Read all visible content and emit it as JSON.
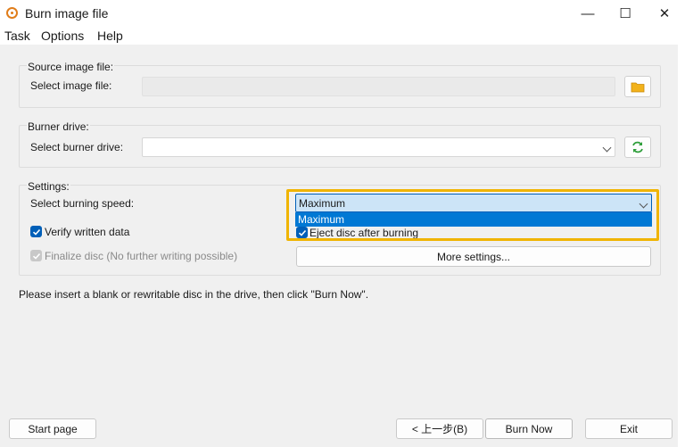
{
  "window": {
    "title": "Burn image file",
    "controls": {
      "minimize": "—",
      "maximize": "☐",
      "close": "✕"
    }
  },
  "menu": [
    "Task",
    "Options",
    "Help"
  ],
  "source": {
    "group_label": "Source image file:",
    "field_label": "Select image file:",
    "value": ""
  },
  "burner": {
    "group_label": "Burner drive:",
    "field_label": "Select burner drive:",
    "value": ""
  },
  "settings": {
    "group_label": "Settings:",
    "speed_label": "Select burning speed:",
    "speed_value": "Maximum",
    "speed_options": [
      "Maximum"
    ],
    "verify_label": "Verify written data",
    "verify_checked": true,
    "finalize_label": "Finalize disc (No further writing possible)",
    "finalize_checked": true,
    "eject_label": "Eject disc after burning",
    "eject_checked": true,
    "more_settings": "More settings..."
  },
  "status_text": "Please insert a blank or rewritable disc in the drive, then click \"Burn Now\".",
  "footer": {
    "start_page": "Start page",
    "back": "< 上一步(B)",
    "burn_now": "Burn Now",
    "exit": "Exit"
  },
  "colors": {
    "accent": "#005fb8",
    "highlight": "#f0b400",
    "folder": "#f2b21b",
    "refresh": "#2e9e3a"
  }
}
